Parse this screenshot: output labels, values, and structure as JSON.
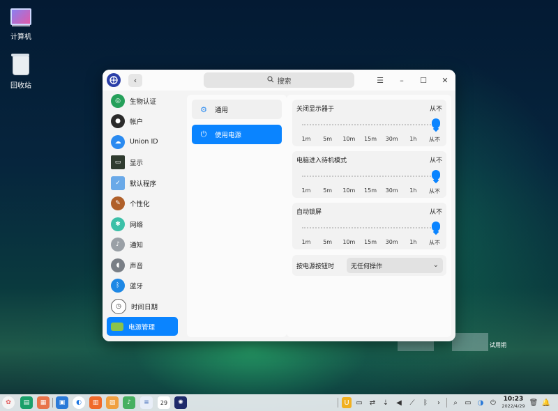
{
  "desktop": {
    "icons": [
      {
        "label": "计算机"
      },
      {
        "label": "回收站"
      }
    ],
    "trial_text": "试用期"
  },
  "window": {
    "search_placeholder": "搜索",
    "sidebar": [
      {
        "label": "生物认证",
        "icon": "fingerprint-icon"
      },
      {
        "label": "帐户",
        "icon": "account-icon"
      },
      {
        "label": "Union ID",
        "icon": "cloud-icon"
      },
      {
        "label": "显示",
        "icon": "display-icon"
      },
      {
        "label": "默认程序",
        "icon": "default-apps-icon"
      },
      {
        "label": "个性化",
        "icon": "palette-icon"
      },
      {
        "label": "网络",
        "icon": "network-icon"
      },
      {
        "label": "通知",
        "icon": "bell-icon"
      },
      {
        "label": "声音",
        "icon": "speaker-icon"
      },
      {
        "label": "蓝牙",
        "icon": "bluetooth-icon"
      },
      {
        "label": "时间日期",
        "icon": "clock-icon"
      },
      {
        "label": "电源管理",
        "icon": "battery-icon",
        "active": true
      }
    ],
    "middle": [
      {
        "label": "通用",
        "icon": "gear-icon"
      },
      {
        "label": "使用电源",
        "icon": "plug-icon",
        "active": true
      }
    ],
    "sliders": [
      {
        "title": "关闭显示器于",
        "value": "从不",
        "level": 1.0
      },
      {
        "title": "电脑进入待机模式",
        "value": "从不",
        "level": 1.0
      },
      {
        "title": "自动锁屏",
        "value": "从不",
        "level": 1.0
      }
    ],
    "ticks": [
      "1m",
      "5m",
      "10m",
      "15m",
      "30m",
      "1h",
      "从不"
    ],
    "power_button": {
      "label": "按电源按钮时",
      "selected": "无任何操作"
    }
  },
  "taskbar": {
    "clock_time": "10:23",
    "clock_date": "2022/4/29",
    "calendar_day": "29"
  },
  "colors": {
    "accent": "#0a84ff"
  }
}
